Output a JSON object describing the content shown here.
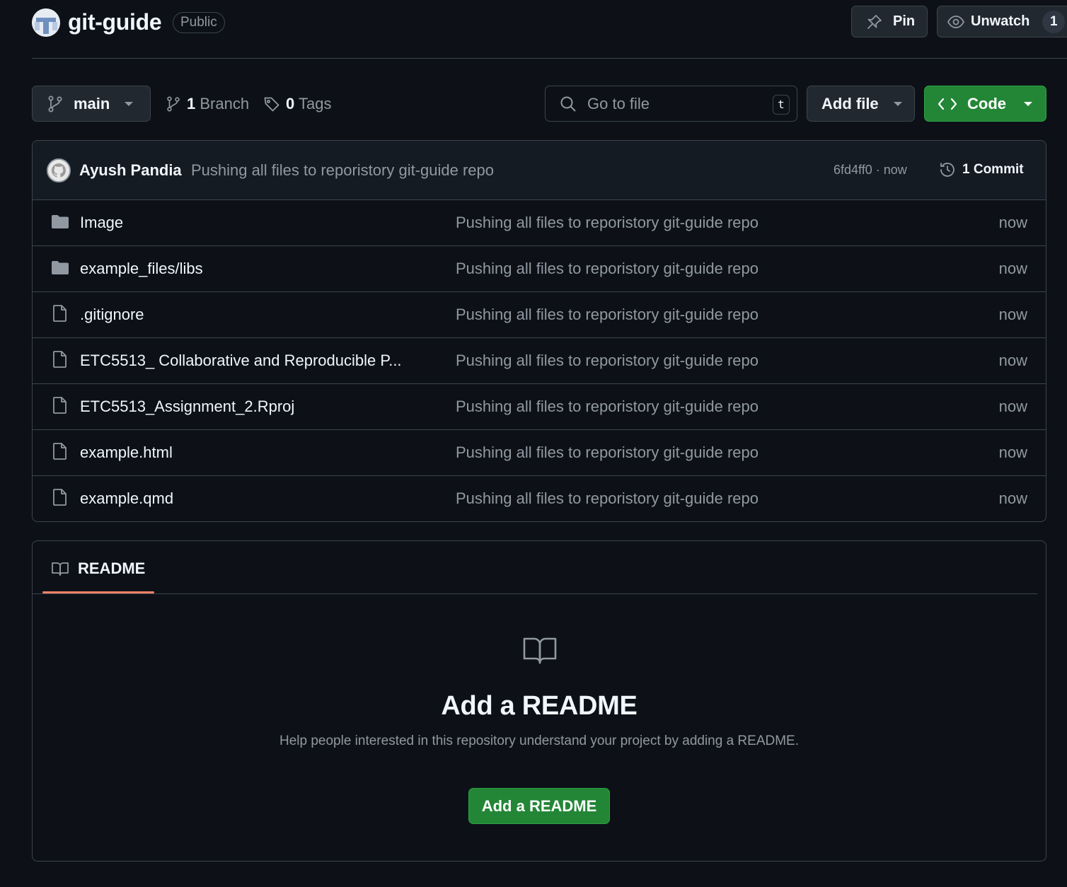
{
  "repo": {
    "name": "git-guide",
    "visibility": "Public"
  },
  "header": {
    "pin_label": "Pin",
    "unwatch_label": "Unwatch",
    "watch_count": "1"
  },
  "toolbar": {
    "branch": "main",
    "branch_count": "1",
    "branch_label": "Branch",
    "tag_count": "0",
    "tag_label": "Tags",
    "search_placeholder": "Go to file",
    "search_shortcut": "t",
    "add_file_label": "Add file",
    "code_label": "Code"
  },
  "latest_commit": {
    "author": "Ayush Pandia",
    "message": "Pushing all files to reporistory git-guide repo",
    "sha_time": "6fd4ff0 · now",
    "commit_count_label": "1 Commit"
  },
  "files": [
    {
      "type": "folder",
      "name": "Image",
      "commit": "Pushing all files to reporistory git-guide repo",
      "age": "now"
    },
    {
      "type": "folder",
      "name": "example_files/libs",
      "commit": "Pushing all files to reporistory git-guide repo",
      "age": "now"
    },
    {
      "type": "file",
      "name": ".gitignore",
      "commit": "Pushing all files to reporistory git-guide repo",
      "age": "now"
    },
    {
      "type": "file",
      "name": "ETC5513_ Collaborative and Reproducible P...",
      "commit": "Pushing all files to reporistory git-guide repo",
      "age": "now"
    },
    {
      "type": "file",
      "name": "ETC5513_Assignment_2.Rproj",
      "commit": "Pushing all files to reporistory git-guide repo",
      "age": "now"
    },
    {
      "type": "file",
      "name": "example.html",
      "commit": "Pushing all files to reporistory git-guide repo",
      "age": "now"
    },
    {
      "type": "file",
      "name": "example.qmd",
      "commit": "Pushing all files to reporistory git-guide repo",
      "age": "now"
    }
  ],
  "readme": {
    "tab_label": "README",
    "heading": "Add a README",
    "help_text": "Help people interested in this repository understand your project by adding a README.",
    "button_label": "Add a README"
  },
  "colors": {
    "background": "#0d1117",
    "accent_green": "#238636",
    "tab_underline": "#f78166",
    "muted_text": "#9198a1",
    "border": "#3d444d"
  },
  "icons": {
    "branch": "git-branch-icon",
    "tag": "tag-icon",
    "search": "search-icon",
    "pin": "pin-icon",
    "eye": "eye-icon",
    "code": "code-icon",
    "history": "history-icon",
    "folder": "folder-icon",
    "file": "file-icon",
    "book": "book-icon"
  }
}
